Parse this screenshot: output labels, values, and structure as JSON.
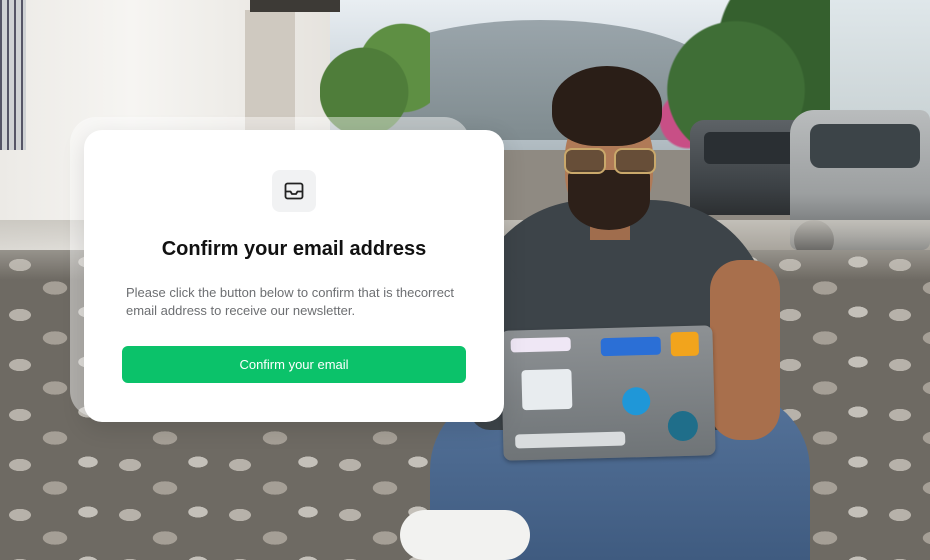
{
  "modal": {
    "icon": "inbox-icon",
    "title": "Confirm your email address",
    "body": "Please click the button below to confirm that is thecorrect email address to receive our newsletter.",
    "button_label": "Confirm your email",
    "button_color": "#0bc26a"
  },
  "background": {
    "description_icon": "photo-background"
  }
}
